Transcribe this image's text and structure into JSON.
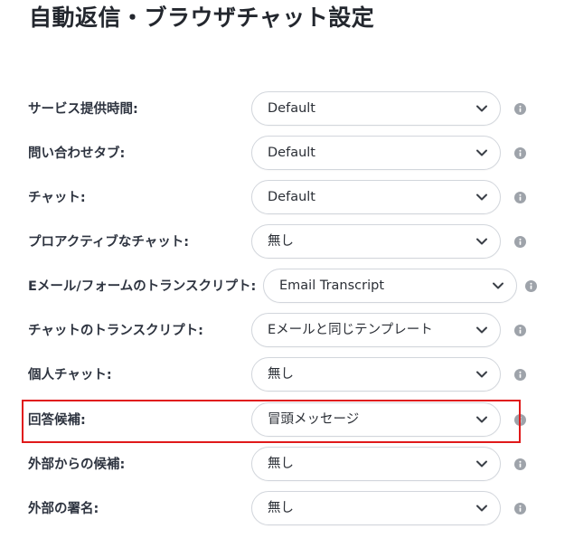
{
  "page": {
    "title": "自動返信・ブラウザチャット設定"
  },
  "settings": [
    {
      "label": "サービス提供時間:",
      "value": "Default"
    },
    {
      "label": "問い合わせタブ:",
      "value": "Default"
    },
    {
      "label": "チャット:",
      "value": "Default"
    },
    {
      "label": "プロアクティブなチャット:",
      "value": "無し"
    },
    {
      "label": "Eメール/フォームのトランスクリプト:",
      "value": "Email Transcript"
    },
    {
      "label": "チャットのトランスクリプト:",
      "value": "Eメールと同じテンプレート"
    },
    {
      "label": "個人チャット:",
      "value": "無し"
    },
    {
      "label": "回答候補:",
      "value": "冒頭メッセージ"
    },
    {
      "label": "外部からの候補:",
      "value": "無し"
    },
    {
      "label": "外部の署名:",
      "value": "無し"
    }
  ],
  "icons": {
    "dropdown": "chevron-down-icon",
    "help": "info-icon"
  },
  "colors": {
    "highlight": "#e0191a",
    "info_icon": "#9ea3aa",
    "select_border": "#d2d6dc"
  },
  "highlighted_row": "回答候補:"
}
